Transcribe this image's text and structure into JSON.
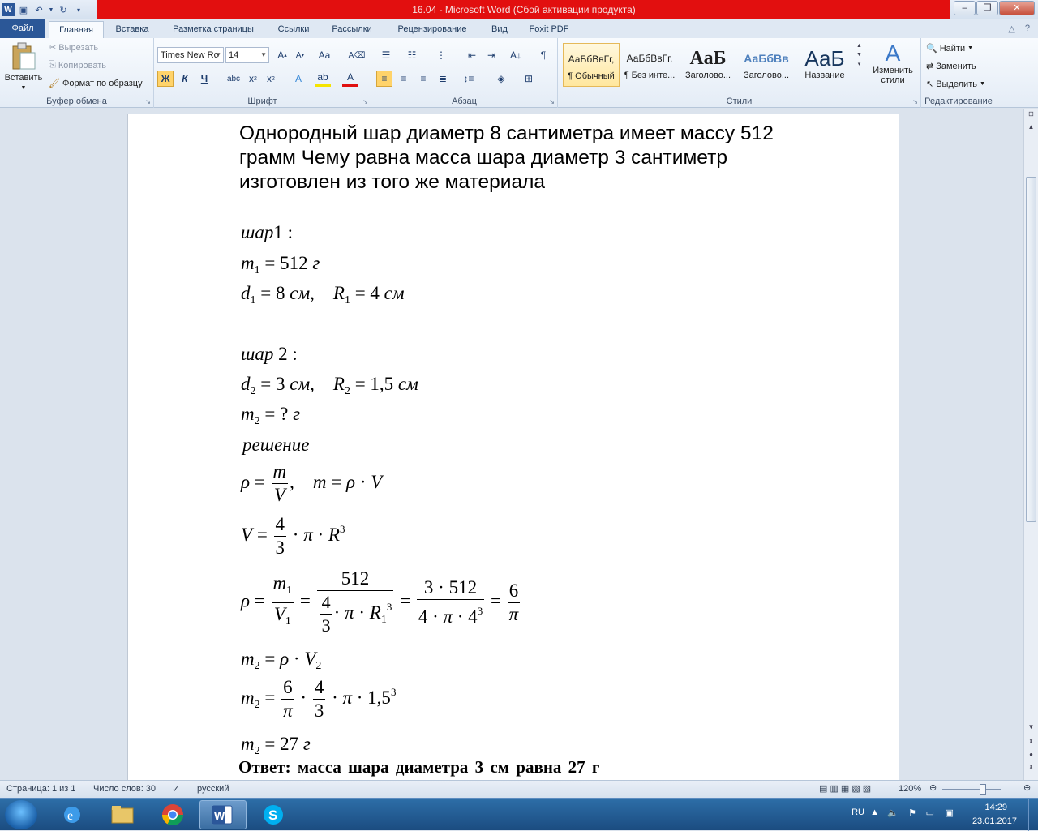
{
  "window": {
    "title": "16.04  -  Microsoft Word (Сбой активации продукта)"
  },
  "tabs": [
    "Файл",
    "Главная",
    "Вставка",
    "Разметка страницы",
    "Ссылки",
    "Рассылки",
    "Рецензирование",
    "Вид",
    "Foxit PDF"
  ],
  "ribbon": {
    "clipboard": {
      "label": "Буфер обмена",
      "paste": "Вставить",
      "cut": "Вырезать",
      "copy": "Копировать",
      "format_painter": "Формат по образцу"
    },
    "font": {
      "label": "Шрифт",
      "font_name": "Times New Rc",
      "font_size": "14",
      "bold": "Ж",
      "italic": "К",
      "underline": "Ч"
    },
    "paragraph": {
      "label": "Абзац"
    },
    "styles": {
      "label": "Стили",
      "items": [
        {
          "preview": "АаБбВвГг,",
          "name": "¶ Обычный"
        },
        {
          "preview": "АаБбВвГг,",
          "name": "¶ Без инте..."
        },
        {
          "preview": "АаБ",
          "name": "Заголово..."
        },
        {
          "preview": "АаБбВв",
          "name": "Заголово..."
        },
        {
          "preview": "АаБ",
          "name": "Название"
        }
      ],
      "change_styles": "Изменить стили"
    },
    "editing": {
      "label": "Редактирование",
      "find": "Найти",
      "replace": "Заменить",
      "select": "Выделить"
    }
  },
  "document": {
    "task": "Однородный шар диаметр 8 сантиметра имеет массу 512 грамм Чему равна масса шара диаметр 3 сантиметр изготовлен из того же материала",
    "ball1_head": "шар",
    "ball1_num": "1 :",
    "ball2_head": "шар",
    "ball2_num": "2 :",
    "solution": "решение",
    "answer": "Ответ: масса шара диаметра 3 см равна 27 г"
  },
  "status": {
    "page": "Страница: 1 из 1",
    "words": "Число слов: 30",
    "language": "русский",
    "zoom": "120%"
  },
  "tray": {
    "lang": "RU",
    "time": "14:29",
    "date": "23.01.2017"
  }
}
